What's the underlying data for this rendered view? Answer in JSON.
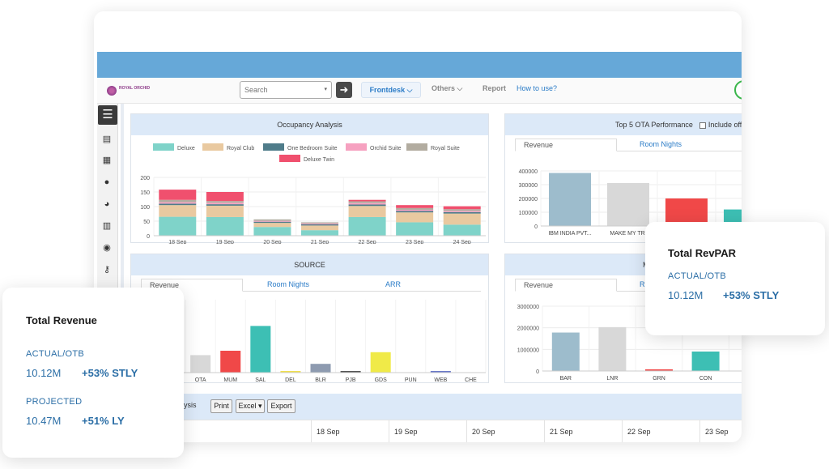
{
  "toolbar": {
    "logo_text": "ROYAL ORCHID",
    "search_placeholder": "Search",
    "nav_frontdesk": "Frontdesk",
    "nav_others": "Others",
    "nav_report": "Report",
    "nav_howto": "How to use?"
  },
  "sidebar": {
    "icons": [
      "menu-icon",
      "clipboard-icon",
      "grid-icon",
      "user-icon",
      "pie-chart-icon",
      "bar-chart-icon",
      "person-badge-icon",
      "key-icon"
    ]
  },
  "occupancy": {
    "title": "Occupancy Analysis",
    "chart_data": {
      "type": "bar",
      "stacked": true,
      "categories": [
        "18 Sep",
        "19 Sep",
        "20 Sep",
        "21 Sep",
        "22 Sep",
        "23 Sep",
        "24 Sep"
      ],
      "series": [
        {
          "name": "Deluxe",
          "color": "#7fd3c9",
          "values": [
            65,
            64,
            30,
            19,
            64,
            46,
            38
          ]
        },
        {
          "name": "Royal Club",
          "color": "#e9c9a0",
          "values": [
            40,
            39,
            14,
            16,
            38,
            34,
            38
          ]
        },
        {
          "name": "One Bedroom Suite",
          "color": "#4f7c8a",
          "values": [
            5,
            5,
            4,
            4,
            5,
            5,
            5
          ]
        },
        {
          "name": "Orchid Suite",
          "color": "#f6a1c0",
          "values": [
            5,
            5,
            3,
            3,
            5,
            4,
            4
          ]
        },
        {
          "name": "Royal Suite",
          "color": "#b2aca0",
          "values": [
            8,
            6,
            5,
            4,
            6,
            6,
            6
          ]
        },
        {
          "name": "Deluxe Twin",
          "color": "#f0506e",
          "values": [
            35,
            31,
            0,
            0,
            5,
            10,
            10
          ]
        }
      ],
      "ylim": [
        0,
        200
      ],
      "yticks": [
        0,
        50,
        100,
        150,
        200
      ],
      "grid": true,
      "legend": "top"
    }
  },
  "ota": {
    "title": "Top 5 OTA Performance",
    "checkbox_label": "Include offl",
    "tabs": [
      "Revenue",
      "Room Nights"
    ],
    "chart_data": {
      "type": "bar",
      "categories": [
        "IBM INDIA PVT...",
        "MAKE MY TRI",
        "",
        ""
      ],
      "values": [
        385000,
        312000,
        200000,
        120000
      ],
      "colors": [
        "#9dbccc",
        "#d8d8d8",
        "#f04848",
        "#3dbfb4"
      ],
      "ylim": [
        0,
        400000
      ],
      "yticks": [
        0,
        100000,
        200000,
        300000,
        400000
      ]
    }
  },
  "source": {
    "title": "SOURCE",
    "tabs": [
      "Revenue",
      "Room Nights",
      "ARR"
    ],
    "chart_data": {
      "type": "bar",
      "categories": [
        "DIR",
        "OTA",
        "MUM",
        "SAL",
        "DEL",
        "BLR",
        "PJB",
        "GDS",
        "PUN",
        "WEB",
        "CHE"
      ],
      "visible_labels": [
        "IR",
        "OTA",
        "MUM",
        "SAL",
        "DEL",
        "BLR",
        "PJB",
        "GDS",
        "PUN",
        "WEB",
        "CHE"
      ],
      "values": [
        7,
        24,
        30,
        64,
        1,
        12,
        2,
        28,
        0,
        1,
        0
      ],
      "colors": [
        "#9dbccc",
        "#d8d8d8",
        "#f04848",
        "#3dbfb4",
        "#f0e050",
        "#8e9bb0",
        "#555555",
        "#f0ea48",
        "#aaaaaa",
        "#6a78c8",
        "#aaaaaa"
      ],
      "ylim": [
        0,
        100
      ]
    }
  },
  "segment": {
    "title": "M",
    "tabs": [
      "Revenue",
      "R"
    ],
    "chart_data": {
      "type": "bar",
      "categories": [
        "BAR",
        "LNR",
        "GRN",
        "CON",
        "LEI"
      ],
      "values": [
        1780000,
        2030000,
        70000,
        900000,
        0
      ],
      "colors": [
        "#9dbccc",
        "#d8d8d8",
        "#f04848",
        "#3dbfb4",
        "#aaaaaa"
      ],
      "ylim": [
        0,
        3000000
      ],
      "yticks": [
        0,
        1000000,
        2000000,
        3000000
      ]
    }
  },
  "bottom": {
    "analysis_label": "alysis",
    "print_label": "Print",
    "excel_label": "Excel",
    "export_label": "Export",
    "dates": [
      "18 Sep",
      "19 Sep",
      "20 Sep",
      "21 Sep",
      "22 Sep",
      "23 Sep"
    ]
  },
  "total_revenue": {
    "title": "Total Revenue",
    "actual_label": "ACTUAL/OTB",
    "actual_value": "10.12M",
    "actual_delta": "+53% STLY",
    "projected_label": "PROJECTED",
    "projected_value": "10.47M",
    "projected_delta": "+51% LY"
  },
  "total_revpar": {
    "title": "Total RevPAR",
    "actual_label": "ACTUAL/OTB",
    "actual_value": "10.12M",
    "actual_delta": "+53% STLY"
  },
  "colors": {
    "accent": "#2b6ea6",
    "top_band": "#66a8d8",
    "panel_header": "#dce9f8"
  }
}
